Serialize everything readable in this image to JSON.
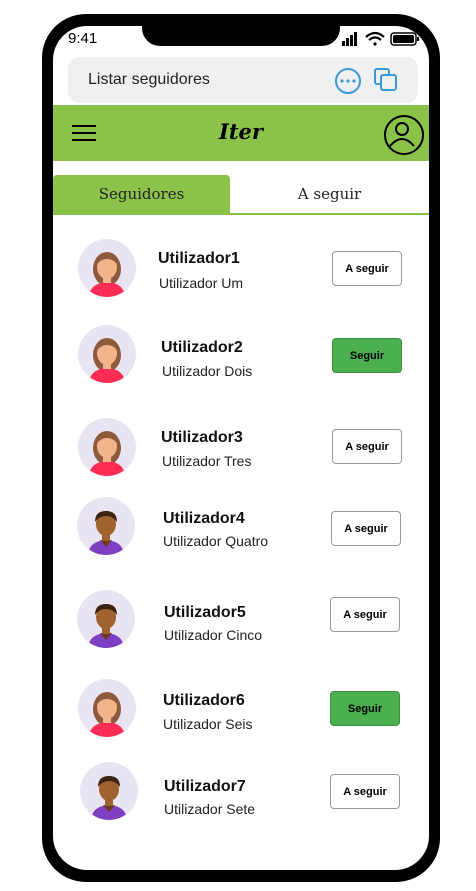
{
  "status_bar": {
    "time": "9:41"
  },
  "url_bar": {
    "title": "Listar seguidores"
  },
  "app_bar": {
    "title": "Iter"
  },
  "tabs": [
    {
      "label": "Seguidores",
      "active": true
    },
    {
      "label": "A seguir",
      "active": false
    }
  ],
  "users": [
    {
      "username": "Utilizador1",
      "display_name": "Utilizador Um",
      "button": "A seguir",
      "button_style": "outline",
      "avatar": "woman-avatar-icon"
    },
    {
      "username": "Utilizador2",
      "display_name": "Utilizador Dois",
      "button": "Seguir",
      "button_style": "filled",
      "avatar": "woman-avatar-icon"
    },
    {
      "username": "Utilizador3",
      "display_name": "Utilizador Tres",
      "button": "A seguir",
      "button_style": "outline",
      "avatar": "woman-avatar-icon"
    },
    {
      "username": "Utilizador4",
      "display_name": "Utilizador Quatro",
      "button": "A seguir",
      "button_style": "outline",
      "avatar": "man-avatar-icon"
    },
    {
      "username": "Utilizador5",
      "display_name": "Utilizador Cinco",
      "button": "A seguir",
      "button_style": "outline",
      "avatar": "man-avatar-icon"
    },
    {
      "username": "Utilizador6",
      "display_name": "Utilizador Seis",
      "button": "Seguir",
      "button_style": "filled",
      "avatar": "woman-avatar-icon"
    },
    {
      "username": "Utilizador7",
      "display_name": "Utilizador Sete",
      "button": "A seguir",
      "button_style": "outline",
      "avatar": "man-avatar-icon"
    }
  ],
  "colors": {
    "accent": "#8bc34a",
    "follow_button": "#4caf50",
    "link_blue": "#3a9ad9"
  }
}
